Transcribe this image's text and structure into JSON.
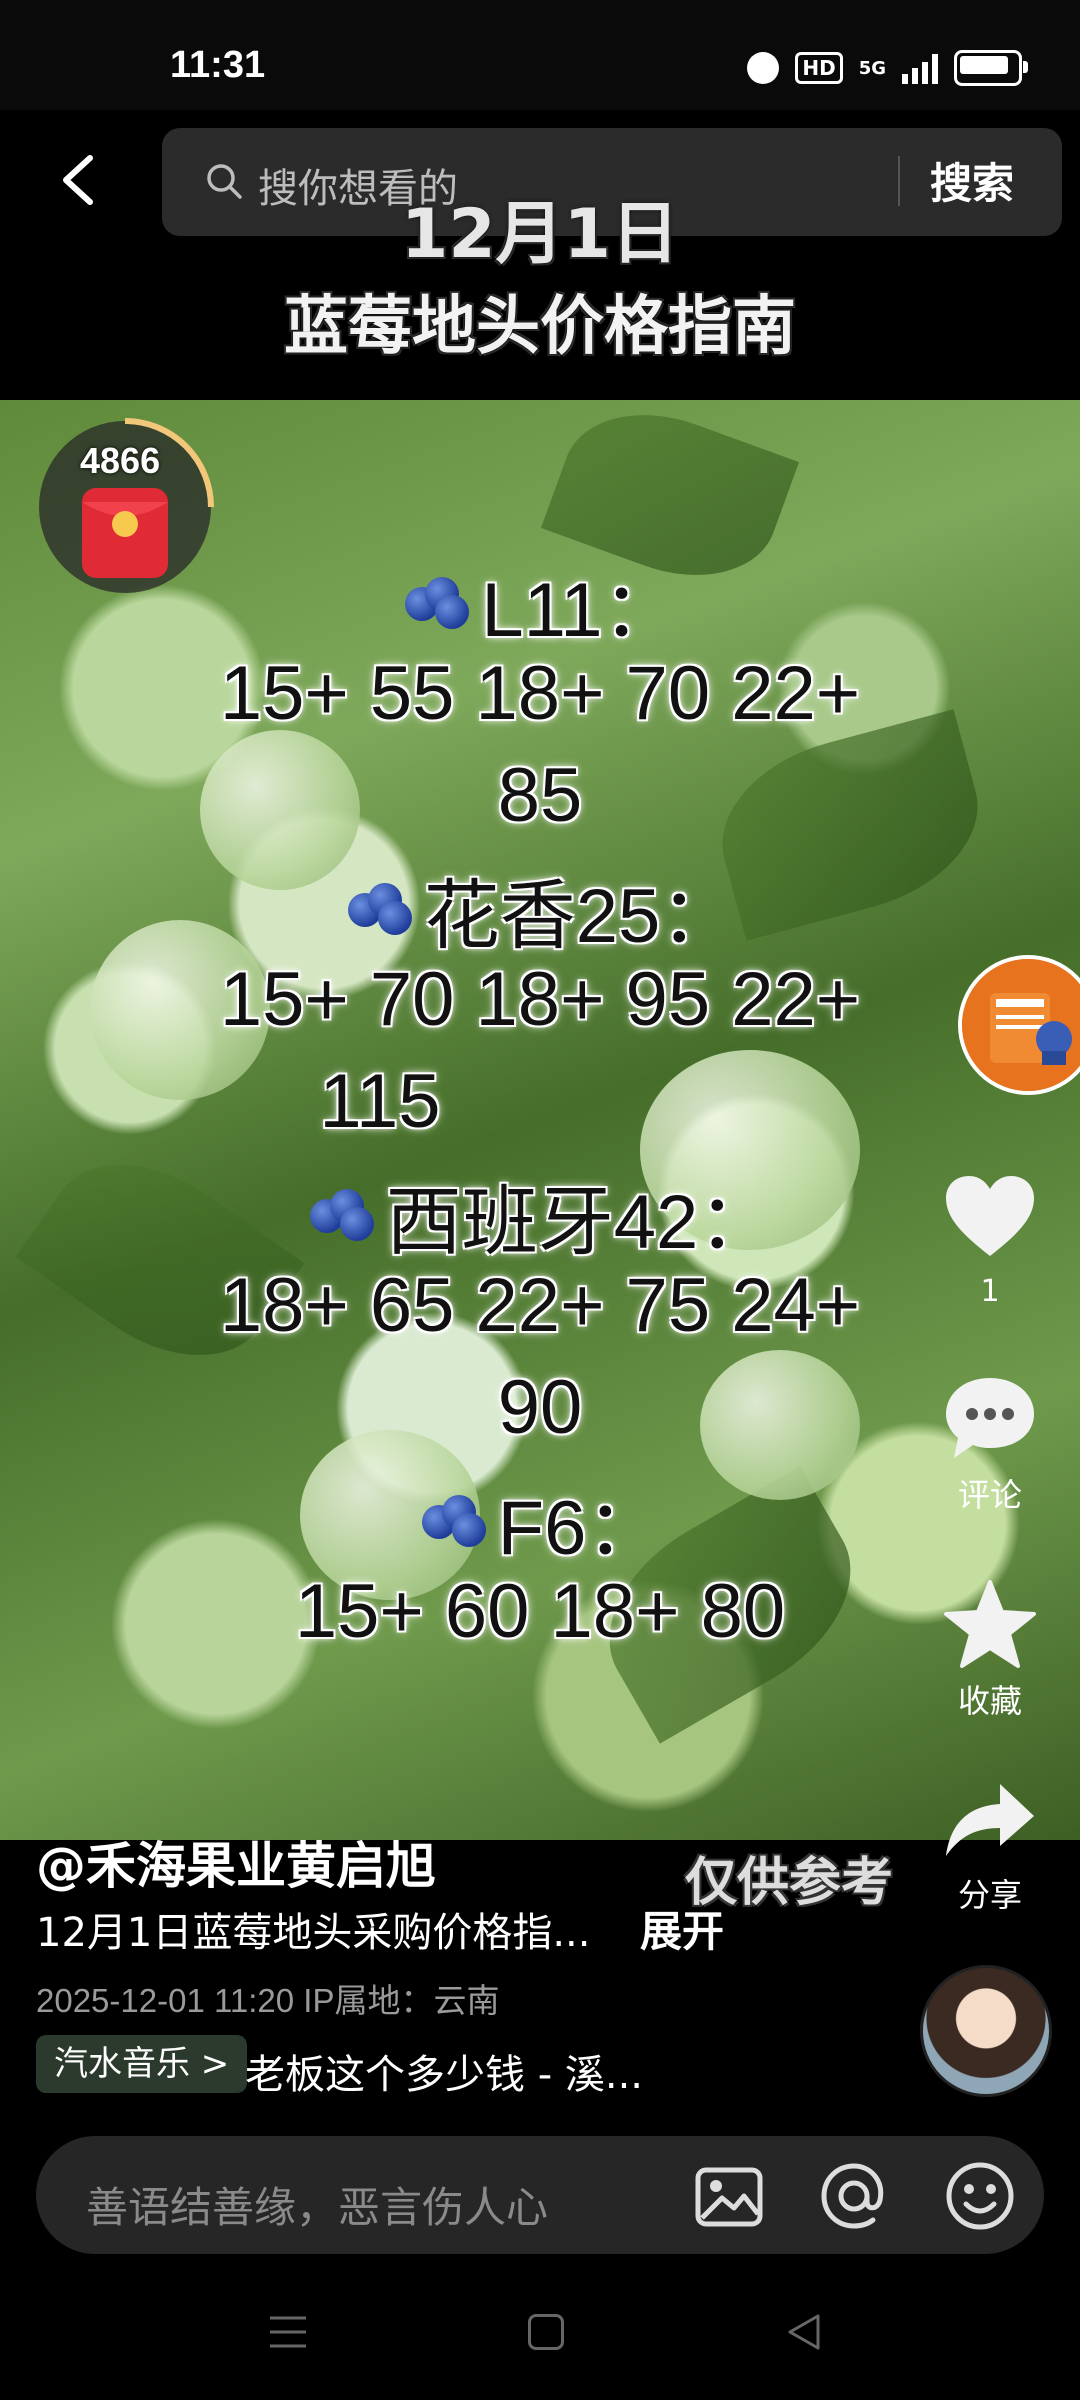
{
  "status_bar": {
    "time": "11:31",
    "hd": "HD",
    "network": "5G"
  },
  "search": {
    "placeholder": "搜你想看的",
    "button_label": "搜索"
  },
  "video": {
    "date": "12月1日",
    "title": "蓝莓地头价格指南",
    "varieties": [
      {
        "name": "L11：",
        "prices": "15+ 55 18+ 70 22+",
        "prices_cont": "85"
      },
      {
        "name": "花香25：",
        "prices": "15+ 70 18+ 95 22+",
        "prices_cont": "115"
      },
      {
        "name": "西班牙42：",
        "prices": "18+ 65  22+ 75 24+",
        "prices_cont": "90"
      },
      {
        "name": "F6：",
        "prices": "15+ 60  18+ 80",
        "prices_cont": ""
      }
    ],
    "watermark": "仅供参考"
  },
  "red_packet": {
    "count": "4866"
  },
  "actions": {
    "like_count": "1",
    "comment_label": "评论",
    "favorite_label": "收藏",
    "share_label": "分享"
  },
  "post": {
    "author": "@禾海果业黄启旭",
    "caption": "12月1日蓝莓地头采购价格指...",
    "expand_label": "展开",
    "meta": "2025-12-01 11:20  IP属地：云南",
    "music_tag": "汽水音乐 >",
    "music_title": "老板这个多少钱 - 溪..."
  },
  "comment_bar": {
    "placeholder": "善语结善缘，恶言伤人心"
  }
}
